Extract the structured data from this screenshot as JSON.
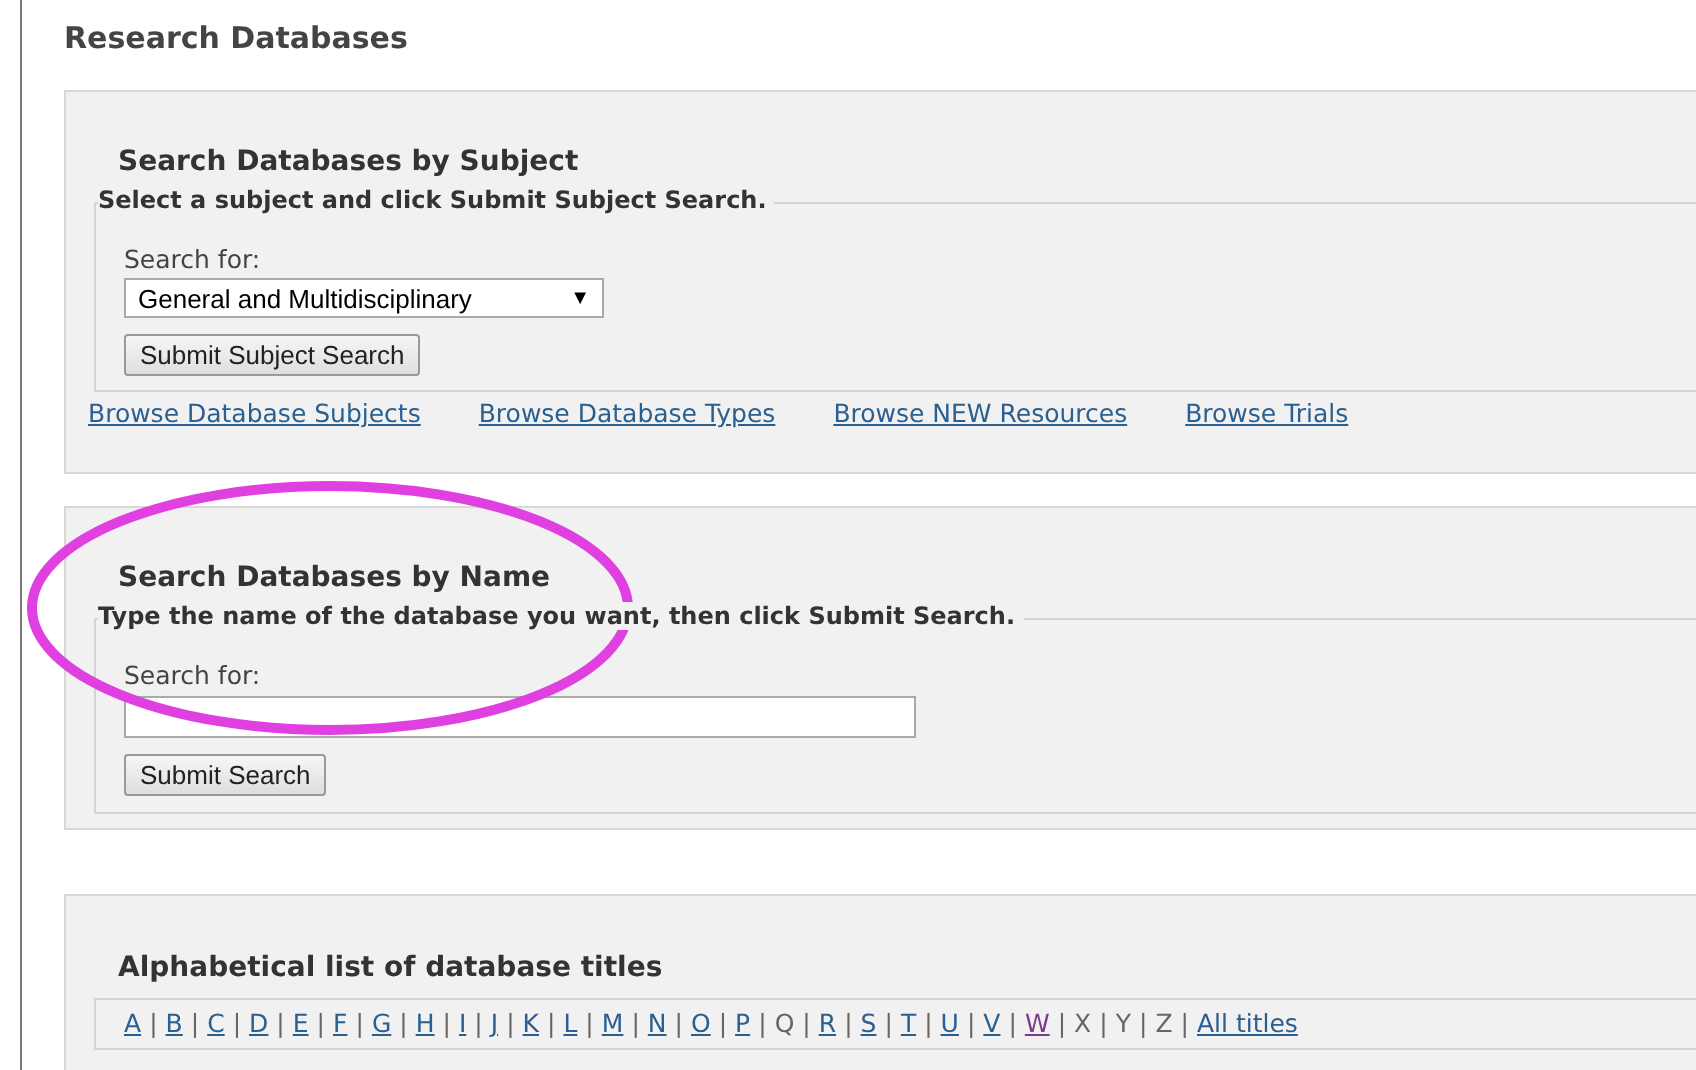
{
  "page_title": "Research Databases",
  "subject_search": {
    "heading": "Search Databases by Subject",
    "legend": "Select a subject and click Submit Subject Search.",
    "label": "Search for:",
    "select_value": "General and Multidisciplinary",
    "select_caret": "▼",
    "button": "Submit Subject Search"
  },
  "browse_links": [
    "Browse Database Subjects",
    "Browse Database Types",
    "Browse NEW Resources",
    "Browse Trials"
  ],
  "name_search": {
    "heading": "Search Databases by Name",
    "legend": "Type the name of the database you want, then click Submit Search.",
    "label": "Search for:",
    "button": "Submit Search"
  },
  "alphabetical": {
    "heading": "Alphabetical list of database titles",
    "separator": "|",
    "items": [
      {
        "label": "A",
        "kind": "link"
      },
      {
        "label": "B",
        "kind": "link"
      },
      {
        "label": "C",
        "kind": "link"
      },
      {
        "label": "D",
        "kind": "link"
      },
      {
        "label": "E",
        "kind": "link"
      },
      {
        "label": "F",
        "kind": "link"
      },
      {
        "label": "G",
        "kind": "link"
      },
      {
        "label": "H",
        "kind": "link"
      },
      {
        "label": "I",
        "kind": "link"
      },
      {
        "label": "J",
        "kind": "link"
      },
      {
        "label": "K",
        "kind": "link"
      },
      {
        "label": "L",
        "kind": "link"
      },
      {
        "label": "M",
        "kind": "link"
      },
      {
        "label": "N",
        "kind": "link"
      },
      {
        "label": "O",
        "kind": "link"
      },
      {
        "label": "P",
        "kind": "link"
      },
      {
        "label": "Q",
        "kind": "plain"
      },
      {
        "label": "R",
        "kind": "link"
      },
      {
        "label": "S",
        "kind": "link"
      },
      {
        "label": "T",
        "kind": "link"
      },
      {
        "label": "U",
        "kind": "link"
      },
      {
        "label": "V",
        "kind": "link"
      },
      {
        "label": "W",
        "kind": "visited"
      },
      {
        "label": "X",
        "kind": "plain"
      },
      {
        "label": "Y",
        "kind": "plain"
      },
      {
        "label": "Z",
        "kind": "plain"
      },
      {
        "label": "All titles",
        "kind": "link"
      }
    ]
  },
  "annotation": {
    "kind": "ellipse",
    "color": "#e040e0"
  }
}
